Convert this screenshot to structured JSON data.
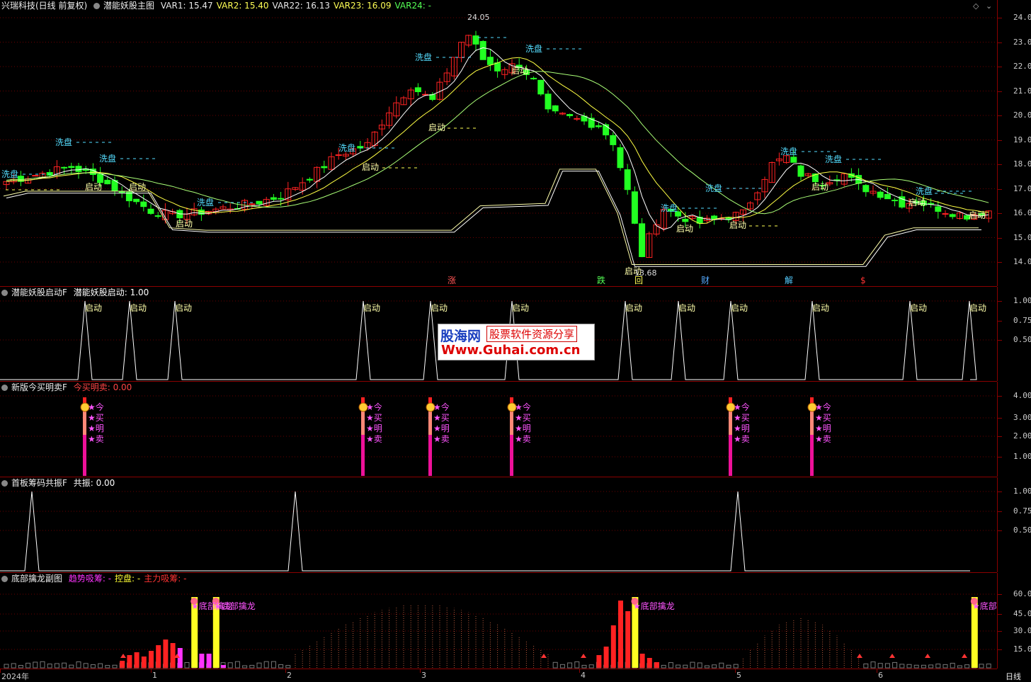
{
  "main": {
    "stock": "兴瑞科技(日线 前复权)",
    "indicator": "潜能妖股主图",
    "vars": [
      {
        "label": "VAR1: 15.47",
        "color": "#e8e8e8"
      },
      {
        "label": "VAR2: 15.40",
        "color": "#ffff55"
      },
      {
        "label": "VAR22: 16.13",
        "color": "#e8e8e8"
      },
      {
        "label": "VAR23: 16.09",
        "color": "#ffff55"
      },
      {
        "label": "VAR24: -",
        "color": "#55ff55"
      }
    ],
    "yticks": [
      "24.00",
      "23.00",
      "22.00",
      "21.00",
      "20.00",
      "19.00",
      "18.00",
      "17.00",
      "16.00",
      "15.00",
      "14.00"
    ],
    "high_label": "24.05",
    "low_label": "13.68",
    "annot_xipan": "洗盘",
    "annot_qidong": "启动",
    "markers": [
      {
        "text": "涨",
        "color": "#ff5555"
      },
      {
        "text": "跌",
        "color": "#55ff55"
      },
      {
        "text": "回",
        "color": "#ffff55"
      },
      {
        "text": "财",
        "color": "#55aaff"
      },
      {
        "text": "解",
        "color": "#55ccff"
      },
      {
        "text": "$",
        "color": "#ff3333"
      }
    ]
  },
  "panel2": {
    "name": "潜能妖股启动F",
    "value_label": "潜能妖股启动: 1.00",
    "label": "启动",
    "yticks": [
      "1.00",
      "0.75",
      "0.50"
    ]
  },
  "panel3": {
    "name": "新版今买明卖F",
    "value_label": "今买明卖: 0.00",
    "chars": [
      "今",
      "买",
      "明",
      "卖"
    ],
    "yticks": [
      "4.00",
      "3.00",
      "2.00",
      "1.00"
    ]
  },
  "panel4": {
    "name": "首板筹码共振F",
    "value_label": "共振: 0.00",
    "yticks": [
      "1.00",
      "0.75",
      "0.50"
    ]
  },
  "panel5": {
    "name": "底部擒龙副图",
    "legend": [
      {
        "label": "趋势吸筹: -",
        "color": "#ff33ff"
      },
      {
        "label": "控盘: -",
        "color": "#ffff33"
      },
      {
        "label": "主力吸筹: -",
        "color": "#ff3333"
      }
    ],
    "label": "★底部擒龙",
    "label_cut": "★底部",
    "yticks": [
      "60.00",
      "45.00",
      "30.00",
      "15.00"
    ]
  },
  "xaxis": {
    "labels": [
      "2024年",
      "1",
      "2",
      "3",
      "4",
      "5",
      "6"
    ],
    "period": "日线"
  },
  "watermark": {
    "brand": "股海网",
    "slogan": "股票软件资源分享",
    "url": "Www.Guhai.com.cn"
  },
  "colors": {
    "up": "#ff2222",
    "down": "#22ff22",
    "ma1": "#ffffff",
    "ma2": "#ffff44",
    "ma3": "#aaff77"
  }
}
